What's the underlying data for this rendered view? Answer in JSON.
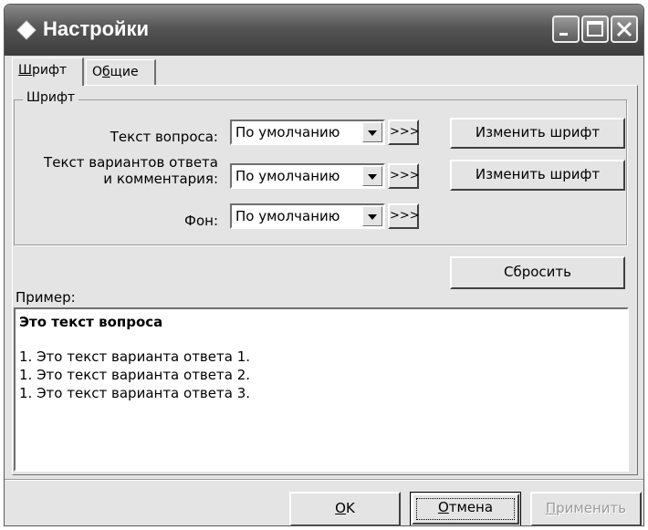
{
  "window": {
    "title": "Настройки",
    "icons": {
      "app": "diamond-icon",
      "minimize": "minimize-icon",
      "maximize": "maximize-icon",
      "close": "close-icon"
    }
  },
  "tabs": [
    {
      "label": "Шрифт",
      "mnemonic": "Ш",
      "rest": "рифт",
      "selected": true
    },
    {
      "label": "Общие",
      "mnemonic": "б",
      "pre": "О",
      "rest": "щие",
      "selected": false
    }
  ],
  "font_group": {
    "title": "Шрифт",
    "rows": [
      {
        "label": "Текст вопроса:",
        "value": "По умолчанию",
        "more": ">>>"
      },
      {
        "label_line1": "Текст вариантов ответа",
        "label_line2": "и комментария:",
        "value": "По умолчанию",
        "more": ">>>"
      },
      {
        "label": "Фон:",
        "value": "По умолчанию",
        "more": ">>>"
      }
    ],
    "change_font_label": "Изменить шрифт"
  },
  "reset_label": "Сбросить",
  "preview": {
    "label": "Пример:",
    "question": "Это текст вопроса",
    "answers": [
      "1. Это текст варианта ответа 1.",
      "1. Это текст варианта ответа 2.",
      "1. Это текст варианта ответа 3."
    ]
  },
  "footer": {
    "ok": {
      "mnemonic": "O",
      "rest": "K"
    },
    "cancel": {
      "mnemonic": "О",
      "rest": "тмена"
    },
    "apply": {
      "mnemonic": "П",
      "rest": "рименить",
      "enabled": false
    }
  },
  "colors": {
    "titlebar": "#555555",
    "face": "#e4e4e4",
    "disabled_text": "#9a9a9a"
  }
}
